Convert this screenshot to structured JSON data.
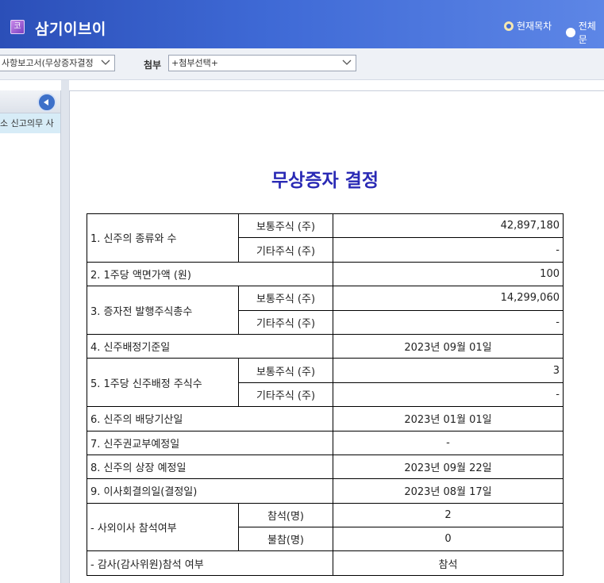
{
  "header": {
    "logo_glyph": "코",
    "company_name": "삼기이브이",
    "radio_current": "현재목차",
    "radio_all": "전체문"
  },
  "toolbar": {
    "report_select_value": "사항보고서(무상증자결정",
    "attach_label": "첨부",
    "attach_select_value": "+첨부선택+"
  },
  "toc": {
    "items": [
      "소 신고의무 사"
    ]
  },
  "document": {
    "title": "무상증자 결정",
    "rows": {
      "r1_label": "1. 신주의 종류와 수",
      "r1_sub1": "보통주식 (주)",
      "r1_val1": "42,897,180",
      "r1_sub2": "기타주식 (주)",
      "r1_val2": "-",
      "r2_label": "2. 1주당 액면가액 (원)",
      "r2_val": "100",
      "r3_label": "3. 증자전 발행주식총수",
      "r3_sub1": "보통주식 (주)",
      "r3_val1": "14,299,060",
      "r3_sub2": "기타주식 (주)",
      "r3_val2": "-",
      "r4_label": "4. 신주배정기준일",
      "r4_val": "2023년 09월 01일",
      "r5_label": "5. 1주당 신주배정 주식수",
      "r5_sub1": "보통주식 (주)",
      "r5_val1": "3",
      "r5_sub2": "기타주식 (주)",
      "r5_val2": "-",
      "r6_label": "6. 신주의 배당기산일",
      "r6_val": "2023년 01월 01일",
      "r7_label": "7. 신주권교부예정일",
      "r7_val": "-",
      "r8_label": "8. 신주의 상장 예정일",
      "r8_val": "2023년 09월 22일",
      "r9_label": "9. 이사회결의일(결정일)",
      "r9_val": "2023년 08월 17일",
      "r10_label": "- 사외이사 참석여부",
      "r10_sub1": "참석(명)",
      "r10_val1": "2",
      "r10_sub2": "불참(명)",
      "r10_val2": "0",
      "r11_label": "- 감사(감사위원)참석 여부",
      "r11_val": "참석"
    }
  },
  "colors": {
    "header_blue": "#3f6ad6",
    "title_blue": "#2a2ab5",
    "toc_highlight": "#d7ecf7"
  }
}
